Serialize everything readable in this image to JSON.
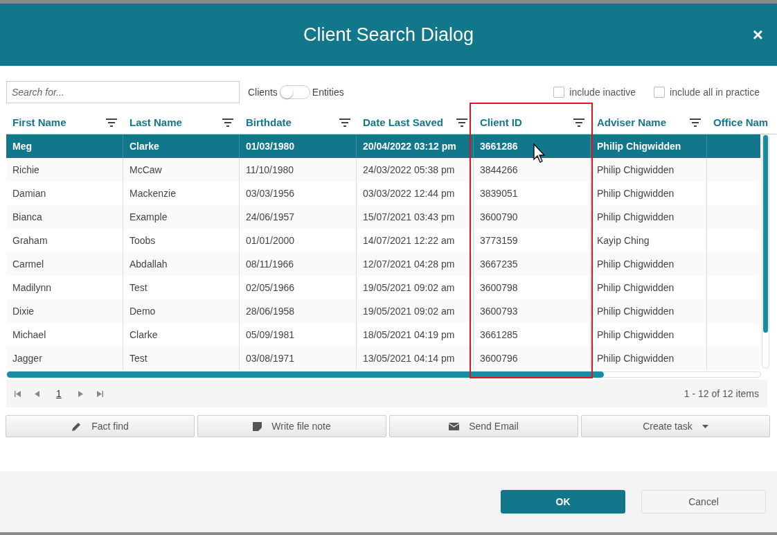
{
  "window": {
    "title": "Client Search Dialog",
    "close": "×"
  },
  "search": {
    "placeholder": "Search for..."
  },
  "toggle": {
    "left_label": "Clients",
    "right_label": "Entities",
    "on": false
  },
  "options": [
    {
      "label": "include inactive",
      "checked": false
    },
    {
      "label": "include all in practice",
      "checked": false
    }
  ],
  "table": {
    "columns": [
      "First Name",
      "Last Name",
      "Birthdate",
      "Date Last Saved",
      "Client ID",
      "Adviser Name",
      "Office Nam"
    ],
    "rows": [
      {
        "selected": true,
        "cells": [
          "Meg",
          "Clarke",
          "01/03/1980",
          "20/04/2022 03:12 pm",
          "3661286",
          "Philip Chigwidden"
        ]
      },
      {
        "selected": false,
        "cells": [
          "Richie",
          "McCaw",
          "11/10/1980",
          "24/03/2022 05:38 pm",
          "3844266",
          "Philip Chigwidden"
        ]
      },
      {
        "selected": false,
        "cells": [
          "Damian",
          "Mackenzie",
          "03/03/1956",
          "03/03/2022 12:44 pm",
          "3839051",
          "Philip Chigwidden"
        ]
      },
      {
        "selected": false,
        "cells": [
          "Bianca",
          "Example",
          "24/06/1957",
          "15/07/2021 03:43 pm",
          "3600790",
          "Philip Chigwidden"
        ]
      },
      {
        "selected": false,
        "cells": [
          "Graham",
          "Toobs",
          "01/01/2000",
          "14/07/2021 12:22 am",
          "3773159",
          "Kayip Ching"
        ]
      },
      {
        "selected": false,
        "cells": [
          "Carmel",
          "Abdallah",
          "08/11/1966",
          "12/07/2021 04:28 pm",
          "3667235",
          "Philip Chigwidden"
        ]
      },
      {
        "selected": false,
        "cells": [
          "Madilynn",
          "Test",
          "02/05/1966",
          "19/05/2021 09:02 am",
          "3600798",
          "Philip Chigwidden"
        ]
      },
      {
        "selected": false,
        "cells": [
          "Dixie",
          "Demo",
          "28/06/1958",
          "19/05/2021 09:02 am",
          "3600793",
          "Philip Chigwidden"
        ]
      },
      {
        "selected": false,
        "cells": [
          "Michael",
          "Clarke",
          "05/09/1981",
          "18/05/2021 04:19 pm",
          "3661285",
          "Philip Chigwidden"
        ]
      },
      {
        "selected": false,
        "cells": [
          "Jagger",
          "Test",
          "03/08/1971",
          "13/05/2021 04:14 pm",
          "3600796",
          "Philip Chigwidden"
        ]
      }
    ]
  },
  "pager": {
    "page": "1",
    "summary": "1 - 12 of 12 items"
  },
  "actions": [
    {
      "label": "Fact find",
      "kind": "pencil"
    },
    {
      "label": "Write file note",
      "kind": "note"
    },
    {
      "label": "Send Email",
      "kind": "mail"
    },
    {
      "label": "Create task",
      "kind": "dropdown"
    }
  ],
  "footer_buttons": [
    {
      "label": "OK",
      "kind": "primary"
    },
    {
      "label": "Cancel",
      "kind": "secondary"
    }
  ]
}
